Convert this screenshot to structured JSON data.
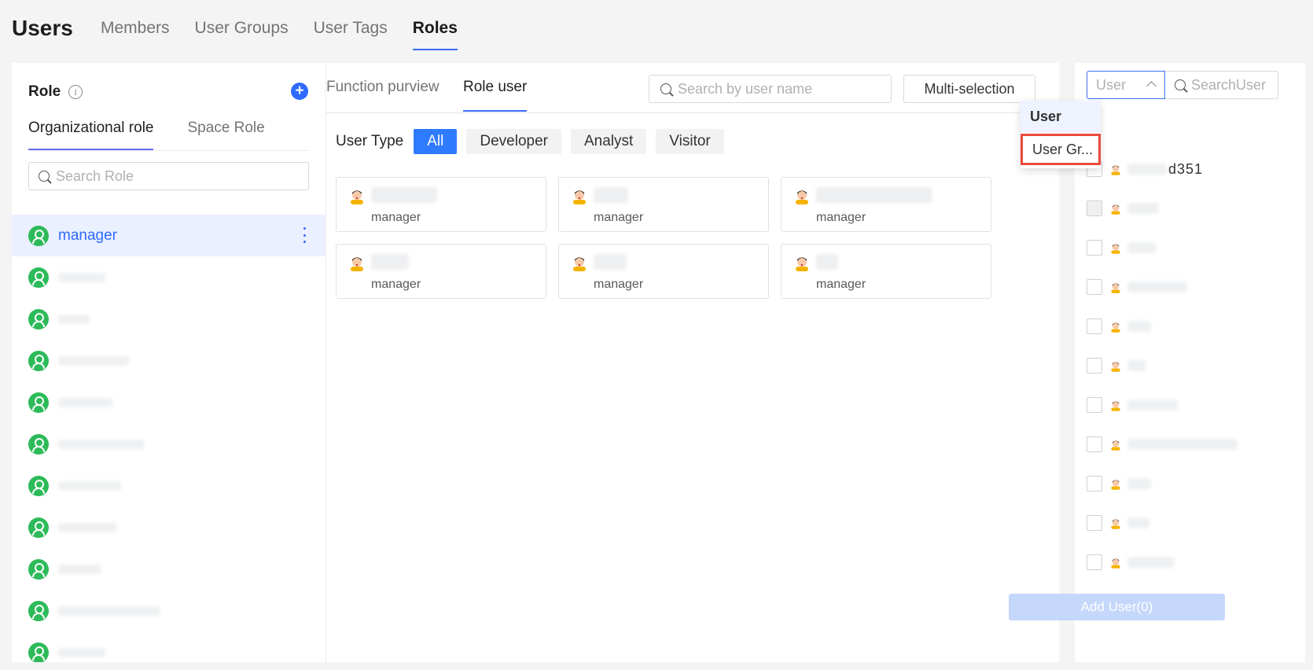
{
  "header": {
    "title": "Users",
    "tabs": [
      "Members",
      "User Groups",
      "User Tags",
      "Roles"
    ],
    "active_tab": "Roles"
  },
  "left_panel": {
    "title": "Role",
    "info_icon": "info-icon",
    "add_icon": "plus-circle-icon",
    "tabs": [
      "Organizational role",
      "Space Role"
    ],
    "active_tab": "Organizational role",
    "search_placeholder": "Search Role",
    "roles": [
      {
        "name": "manager",
        "active": true
      },
      {
        "name": ""
      },
      {
        "name": ""
      },
      {
        "name": ""
      },
      {
        "name": ""
      },
      {
        "name": ""
      },
      {
        "name": ""
      },
      {
        "name": ""
      },
      {
        "name": ""
      },
      {
        "name": ""
      },
      {
        "name": ""
      }
    ]
  },
  "center_panel": {
    "tabs": [
      "Function purview",
      "Role user"
    ],
    "active_tab": "Role user",
    "search_placeholder": "Search by user name",
    "multi_selection_label": "Multi-selection",
    "user_type_label": "User Type",
    "user_types": [
      "All",
      "Developer",
      "Analyst",
      "Visitor"
    ],
    "active_user_type": "All",
    "users": [
      {
        "role": "manager"
      },
      {
        "role": "manager"
      },
      {
        "role": "manager"
      },
      {
        "role": "manager"
      },
      {
        "role": "manager"
      },
      {
        "role": "manager"
      }
    ]
  },
  "right_panel": {
    "select_value": "User",
    "search_placeholder": "SearchUser",
    "dropdown_options": [
      "User",
      "User Gr..."
    ],
    "dropdown_selected": "User",
    "dropdown_highlighted": "User Gr...",
    "partial_user_text": "d351",
    "add_user_label": "Add User(0)"
  },
  "colors": {
    "accent": "#2f6bff",
    "role_avatar": "#2dbb5a",
    "highlight_border": "#e84a3d",
    "disabled_button": "#c5d7fb"
  }
}
